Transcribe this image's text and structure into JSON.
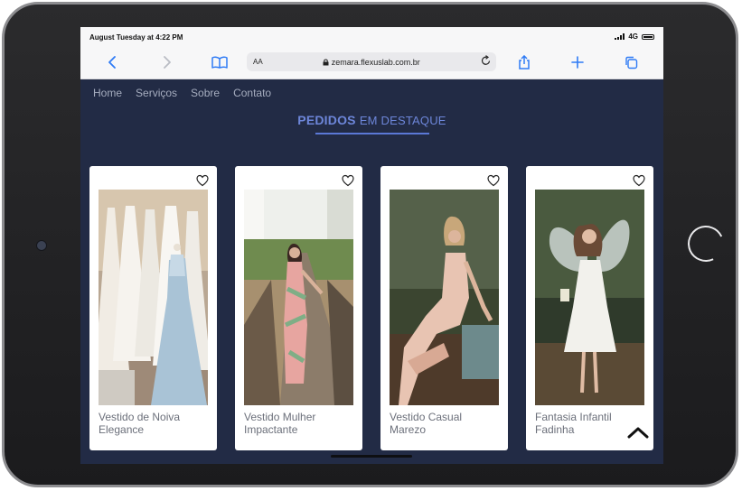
{
  "status": {
    "datetime": "August Tuesday at 4:22 PM",
    "network": "4G"
  },
  "browser": {
    "text_size": "AA",
    "url": "zemara.flexuslab.com.br",
    "icons": [
      "back-icon",
      "forward-icon",
      "bookmarks-icon",
      "lock-icon",
      "reload-icon",
      "share-icon",
      "new-tab-icon",
      "tabs-icon"
    ]
  },
  "nav": {
    "items": [
      "Home",
      "Serviços",
      "Sobre",
      "Contato"
    ]
  },
  "section": {
    "title_bold": "PEDIDOS",
    "title_rest": "EM DESTAQUE",
    "accent_color": "#6d86d9"
  },
  "products": [
    {
      "line1": "Vestido de Noiva",
      "line2": "Elegance"
    },
    {
      "line1": "Vestido Mulher",
      "line2": "Impactante"
    },
    {
      "line1": "Vestido Casual",
      "line2": "Marezo"
    },
    {
      "line1": "Fantasia Infantil",
      "line2": "Fadinha"
    }
  ],
  "colors": {
    "page_bg": "#222b45",
    "card_bg": "#ffffff",
    "link_blue": "#2f7bf5"
  }
}
